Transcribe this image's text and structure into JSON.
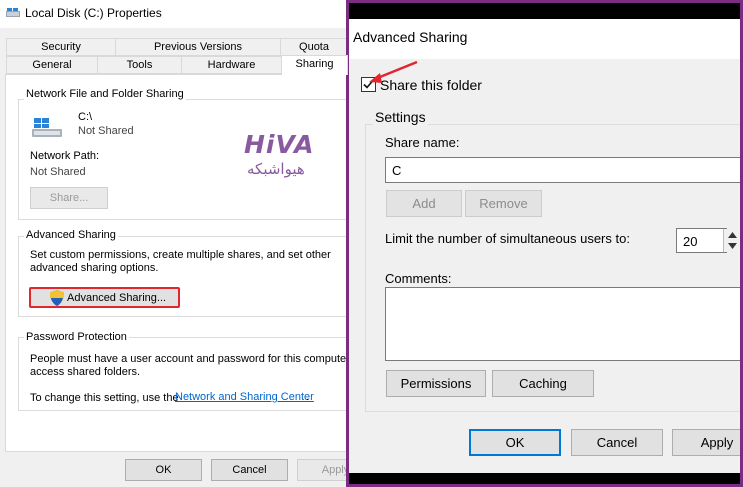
{
  "properties_window": {
    "title": "Local Disk (C:) Properties",
    "tabs_row1": [
      "Security",
      "Previous Versions",
      "Quota"
    ],
    "tabs_row2": [
      "General",
      "Tools",
      "Hardware",
      "Sharing"
    ],
    "network_sharing": {
      "group_title": "Network File and Folder Sharing",
      "drive_name": "C:\\",
      "drive_status": "Not Shared",
      "network_path_label": "Network Path:",
      "network_path_value": "Not Shared",
      "share_button": "Share..."
    },
    "advanced_sharing": {
      "group_title": "Advanced Sharing",
      "description_line1": "Set custom permissions, create multiple shares, and set other",
      "description_line2": "advanced sharing options.",
      "button_label": "Advanced Sharing..."
    },
    "password_protection": {
      "group_title": "Password Protection",
      "text_line1": "People must have a user account and password for this computer to",
      "text_line2": "access shared folders.",
      "change_prefix": "To change this setting, use the ",
      "link_text": "Network and Sharing Center",
      "change_suffix": "."
    },
    "buttons": {
      "ok": "OK",
      "cancel": "Cancel",
      "apply": "Apply"
    }
  },
  "logo": {
    "latin": "HiVA",
    "persian": "هیواشبکه",
    "color": "#8a5aa0"
  },
  "advanced_sharing_dialog": {
    "title": "Advanced Sharing",
    "share_checkbox_label": "Share this folder",
    "share_checkbox_checked": true,
    "settings_title": "Settings",
    "share_name_label": "Share name:",
    "share_name_value": "C",
    "add_button": "Add",
    "remove_button": "Remove",
    "limit_label": "Limit the number of simultaneous users to:",
    "limit_value": "20",
    "comments_label": "Comments:",
    "permissions_button": "Permissions",
    "caching_button": "Caching",
    "ok_button": "OK",
    "cancel_button": "Cancel",
    "apply_button": "Apply"
  },
  "colors": {
    "highlight_red": "#e0262e",
    "frame_purple": "#7b2d82",
    "link_blue": "#0066cc",
    "focus_blue": "#0078d7"
  }
}
